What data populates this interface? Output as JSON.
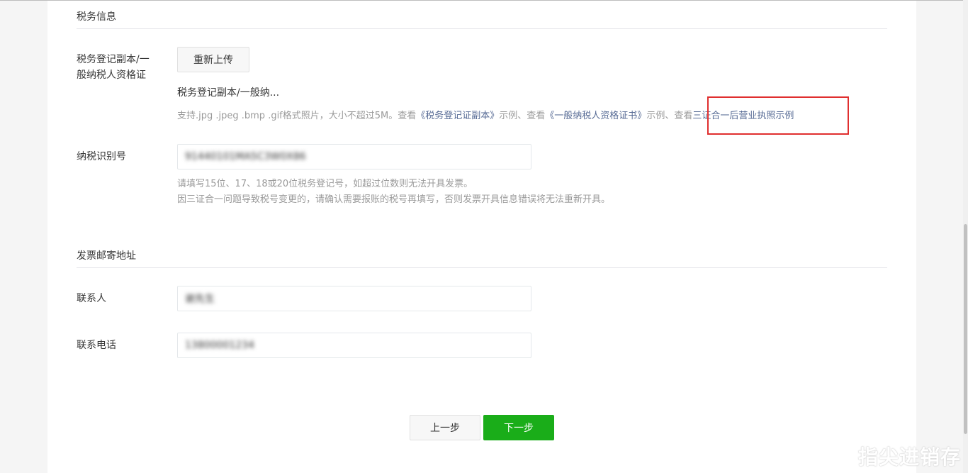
{
  "tax_section": {
    "title": "税务信息",
    "certificate_label_line1": "税务登记副本/一",
    "certificate_label_line2": "般纳税人资格证",
    "reupload_button": "重新上传",
    "uploaded_filename": "税务登记副本/一般纳...",
    "tips_prefix": "支持.jpg .jpeg .bmp .gif格式照片，大小不超过5M。查看",
    "tips_link1": "《税务登记证副本》",
    "tips_sep1": "示例、查看",
    "tips_link2": "《一般纳税人资格证书》",
    "tips_sep2": "示例、查看",
    "tips_link3": "三证合一后营业执照示例",
    "tax_id_label": "纳税识别号",
    "tax_id_value": "91440101MA5C3W0X86",
    "tax_id_hint1": "请填写15位、17、18或20位税务登记号，如超过位数则无法开具发票。",
    "tax_id_hint2": "因三证合一问题导致税号变更的，请确认需要报账的税号再填写，否则发票开具信息错误将无法重新开具。"
  },
  "mail_section": {
    "title": "发票邮寄地址",
    "contact_label": "联系人",
    "contact_value": "谢先生",
    "phone_label": "联系电话",
    "phone_value": "13800001234"
  },
  "footer": {
    "prev_button": "上一步",
    "next_button": "下一步"
  },
  "watermark": "指尖进销存",
  "colors": {
    "accent_green": "#1aad19",
    "link": "#576b95",
    "highlight_red": "#e02f2f"
  }
}
